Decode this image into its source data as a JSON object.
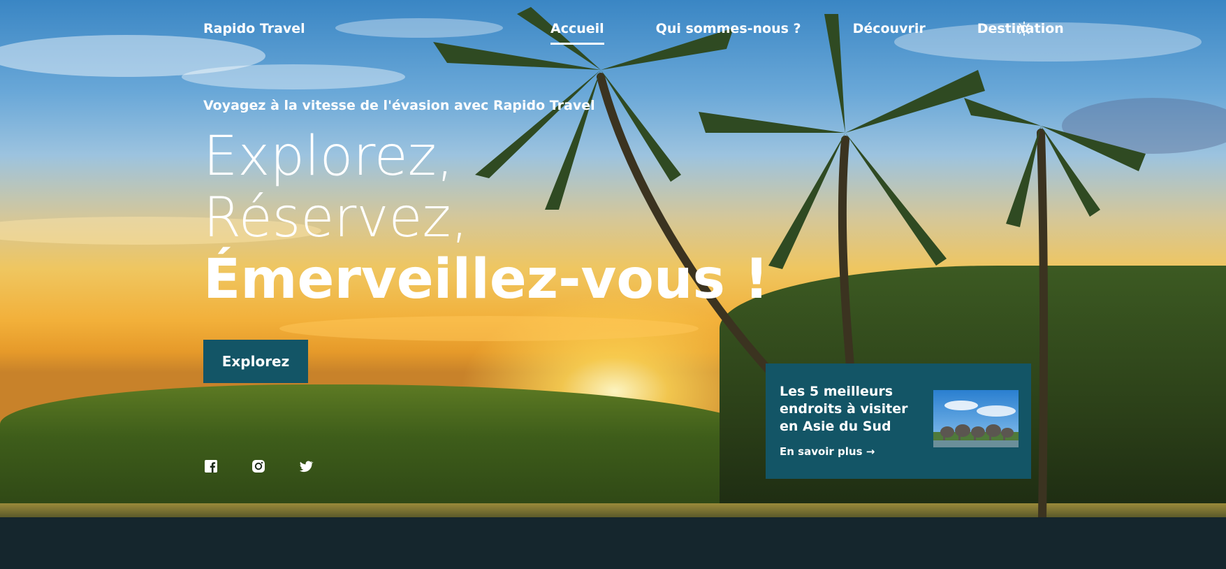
{
  "brand": "Rapido Travel",
  "nav": {
    "items": [
      {
        "label": "Accueil",
        "active": true
      },
      {
        "label": "Qui sommes-nous ?",
        "active": false
      },
      {
        "label": "Découvrir",
        "active": false
      },
      {
        "label": "Destination",
        "active": false
      }
    ],
    "theme_icon": "sun-icon"
  },
  "hero": {
    "tagline": "Voyagez à la vitesse de l'évasion avec Rapido Travel",
    "headline_light_1": "Explorez,",
    "headline_light_2": "Réservez, ",
    "headline_bold": "Émerveillez-vous !",
    "cta_label": "Explorez"
  },
  "socials": [
    {
      "icon": "facebook-icon"
    },
    {
      "icon": "instagram-icon"
    },
    {
      "icon": "twitter-icon"
    }
  ],
  "card": {
    "title": "Les 5 meilleurs endroits à visiter en Asie du Sud",
    "link_label": "En savoir plus",
    "link_icon": "arrow-right-icon",
    "image_icon": "elephants-image"
  },
  "colors": {
    "accent": "#135566",
    "footer": "#15262d",
    "text": "#ffffff"
  }
}
